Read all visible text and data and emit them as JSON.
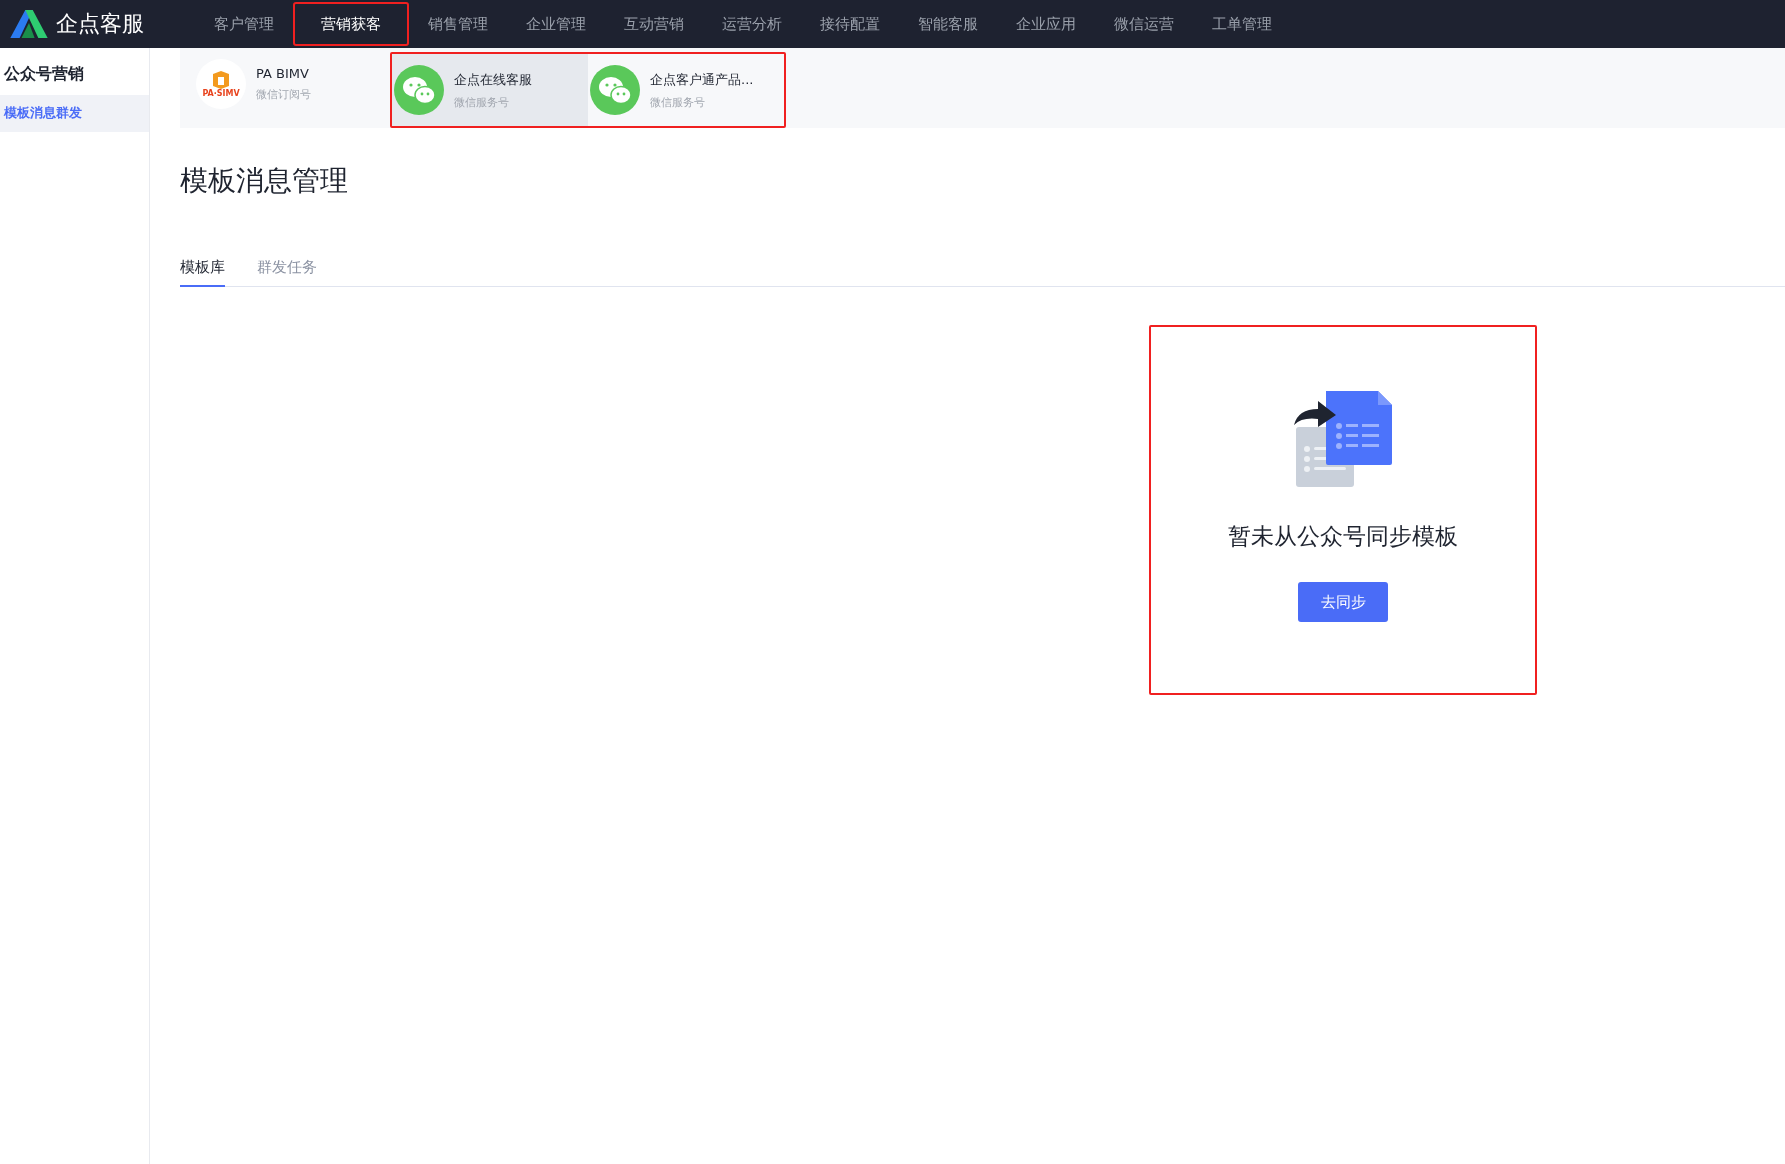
{
  "topbar": {
    "logo_text": "企点客服",
    "nav": [
      {
        "label": "客户管理",
        "selected": false,
        "highlighted": false
      },
      {
        "label": "营销获客",
        "selected": true,
        "highlighted": true
      },
      {
        "label": "销售管理",
        "selected": false,
        "highlighted": false
      },
      {
        "label": "企业管理",
        "selected": false,
        "highlighted": false
      },
      {
        "label": "互动营销",
        "selected": false,
        "highlighted": false
      },
      {
        "label": "运营分析",
        "selected": false,
        "highlighted": false
      },
      {
        "label": "接待配置",
        "selected": false,
        "highlighted": false
      },
      {
        "label": "智能客服",
        "selected": false,
        "highlighted": false
      },
      {
        "label": "企业应用",
        "selected": false,
        "highlighted": false
      },
      {
        "label": "微信运营",
        "selected": false,
        "highlighted": false
      },
      {
        "label": "工单管理",
        "selected": false,
        "highlighted": false
      }
    ]
  },
  "sidebar": {
    "heading": "公众号营销",
    "items": [
      {
        "label": "模板消息群发",
        "selected": true
      }
    ]
  },
  "accounts": [
    {
      "kind": "logo",
      "name": "PA BIMV",
      "logo_text": "PA·SIMV",
      "type": "微信订阅号",
      "selected": false,
      "highlighted": false
    },
    {
      "kind": "wechat",
      "name": "企点在线客服",
      "type": "微信服务号",
      "selected": true,
      "highlighted": true
    },
    {
      "kind": "wechat",
      "name": "企点客户通产品...",
      "type": "微信服务号",
      "selected": false,
      "highlighted": true
    }
  ],
  "page": {
    "title": "模板消息管理",
    "tabs": [
      {
        "label": "模板库",
        "selected": true
      },
      {
        "label": "群发任务",
        "selected": false
      }
    ]
  },
  "empty_state": {
    "message": "暂未从公众号同步模板",
    "button": "去同步",
    "highlighted": true
  }
}
